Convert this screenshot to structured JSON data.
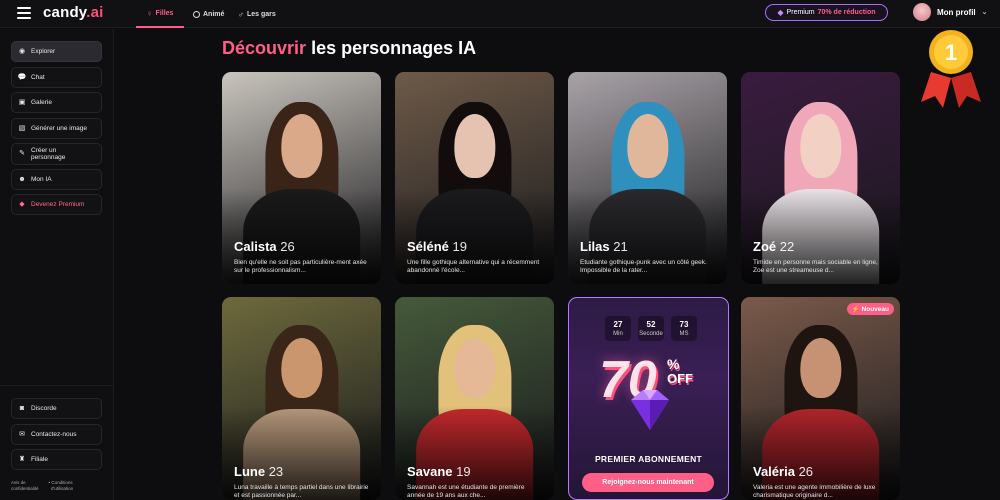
{
  "header": {
    "logo_main": "candy",
    "logo_accent": ".ai",
    "tabs": [
      {
        "label": "Filles",
        "icon": "female-icon",
        "active": true
      },
      {
        "label": "Animé",
        "icon": "anime-icon",
        "active": false
      },
      {
        "label": "Les gars",
        "icon": "male-icon",
        "active": false
      }
    ],
    "premium_prefix": "Premium",
    "premium_discount": "70% de réduction",
    "profile_label": "Mon profil"
  },
  "sidebar": {
    "items": [
      {
        "label": "Explorer",
        "icon": "compass-icon"
      },
      {
        "label": "Chat",
        "icon": "chat-icon"
      },
      {
        "label": "Galerie",
        "icon": "gallery-icon"
      },
      {
        "label": "Générer une image",
        "icon": "image-icon"
      },
      {
        "label_line1": "Créer un",
        "label_line2": "personnage",
        "icon": "create-icon"
      },
      {
        "label": "Mon IA",
        "icon": "mask-icon"
      },
      {
        "label": "Devenez Premium",
        "icon": "diamond-icon"
      }
    ],
    "bottom_items": [
      {
        "label": "Discorde",
        "icon": "discord-icon"
      },
      {
        "label": "Contactez-nous",
        "icon": "mail-icon"
      },
      {
        "label": "Filiale",
        "icon": "trophy-icon"
      }
    ],
    "footer": {
      "privacy_1": "Avis de",
      "privacy_2": "confidentialité",
      "terms_1": "Conditions",
      "terms_2": "d'utilisation"
    }
  },
  "main": {
    "heading_accent": "Découvrir",
    "heading_rest": "les personnages IA",
    "cards": [
      {
        "name": "Calista",
        "age": "26",
        "desc": "Bien qu'elle ne soit pas particulière-ment axée sur le professionnalism...",
        "colors": {
          "bg": "#c9c4bd",
          "hair": "#3a2418",
          "skin": "#d9a98a",
          "outfit": "#1a1a1a"
        }
      },
      {
        "name": "Séléné",
        "age": "19",
        "desc": "Une fille gothique alternative qui a récemment abandonné l'école...",
        "colors": {
          "bg": "#6e5a48",
          "hair": "#120c0c",
          "skin": "#e6c3b1",
          "outfit": "#1b1b1e"
        }
      },
      {
        "name": "Lilas",
        "age": "21",
        "desc": "Étudiante gothique-punk avec un côté geek. Impossible de la rater...",
        "colors": {
          "bg": "#a9a3a8",
          "hair": "#2f8fbd",
          "skin": "#e0b79a",
          "outfit": "#2a2a2e"
        }
      },
      {
        "name": "Zoé",
        "age": "22",
        "desc": "Timide en personne mais sociable en ligne, Zoe est une streameuse d...",
        "colors": {
          "bg": "#3a1b3f",
          "hair": "#f0a7b8",
          "skin": "#f3d0c4",
          "outfit": "#e8e2e6"
        }
      },
      {
        "name": "Lune",
        "age": "23",
        "desc": "Luna travaille à temps partiel dans une librairie et est passionnée par...",
        "colors": {
          "bg": "#6d6a3c",
          "hair": "#3a2618",
          "skin": "#c9966e",
          "outfit": "#b89a7d"
        }
      },
      {
        "name": "Savane",
        "age": "19",
        "desc": "Savannah est une étudiante de première année de 19 ans aux che...",
        "colors": {
          "bg": "#455a3a",
          "hair": "#e2c27a",
          "skin": "#e5b896",
          "outfit": "#c42a2e"
        }
      },
      {
        "name": "Valéria",
        "age": "26",
        "desc": "Valeria est une agente immobilière de luxe charismatique originaire d...",
        "colors": {
          "bg": "#7b5a4a",
          "hair": "#1e1410",
          "skin": "#c79273",
          "outfit": "#b2262c"
        },
        "badge": "Nouveau"
      }
    ],
    "promo": {
      "timer": [
        {
          "value": "27",
          "unit": "Min"
        },
        {
          "value": "52",
          "unit": "Seconde"
        },
        {
          "value": "73",
          "unit": "MS"
        }
      ],
      "big_number": "70",
      "percent": "%",
      "off": "OFF",
      "title": "PREMIER ABONNEMENT",
      "button": "Rejoignez-nous maintenant"
    },
    "medal_number": "1"
  },
  "colors": {
    "accent": "#ff5f86",
    "promo_border": "#b77bff",
    "background": "#0d0d0f"
  }
}
